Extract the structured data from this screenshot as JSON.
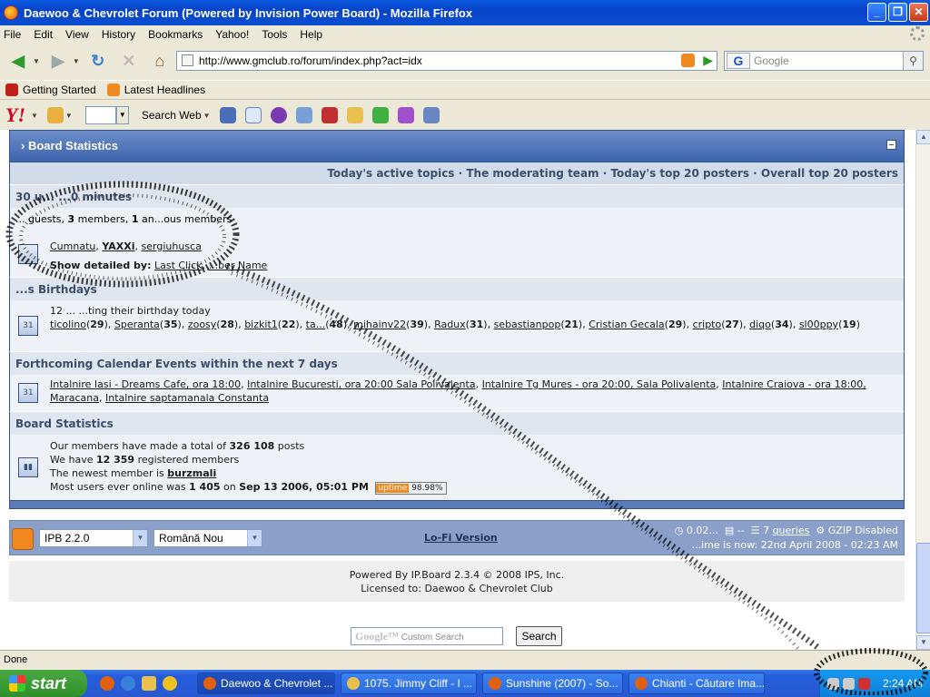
{
  "window": {
    "title": "Daewoo & Chevrolet Forum (Powered by Invision Power Board) - Mozilla Firefox"
  },
  "menu": [
    "File",
    "Edit",
    "View",
    "History",
    "Bookmarks",
    "Yahoo!",
    "Tools",
    "Help"
  ],
  "nav": {
    "url": "http://www.gmclub.ro/forum/index.php?act=idx",
    "search_placeholder": "Google"
  },
  "bookmarks": [
    {
      "label": "Getting Started",
      "icon": "firefox-icon"
    },
    {
      "label": "Latest Headlines",
      "icon": "rss-icon"
    }
  ],
  "yahoo": {
    "logo": "Y!",
    "search_label": "Search Web"
  },
  "board": {
    "title": "Board Statistics",
    "actions": "Today's active topics · The moderating team · Today's top 20 posters · Overall top 20 posters",
    "online_head": "30 u...                                  ...0 minutes",
    "online_summary_1": "... guests, ",
    "online_members_count": "3",
    "online_summary_2": " members, ",
    "online_anon_count": "1",
    "online_summary_3": " an...ous members",
    "online_users": [
      "Cumnatu",
      "YAXXi",
      "sergiuhusca"
    ],
    "detail_label": "Show detailed by:",
    "detail_links": [
      "Last Click",
      "...ber Name"
    ],
    "birthdays_head": "...s Birthdays",
    "birthday_line": "12 ...                          ...ting their birthday today",
    "birthday_users": [
      {
        "name": "ticolino",
        "age": "29"
      },
      {
        "name": "Speranta",
        "age": "35"
      },
      {
        "name": "zoosy",
        "age": "28"
      },
      {
        "name": "bizkit1",
        "age": "22"
      },
      {
        "name": "ta...",
        "age": "48"
      },
      {
        "name": "mihainv22",
        "age": "39"
      },
      {
        "name": "Radux",
        "age": "31"
      },
      {
        "name": "sebastianpop",
        "age": "21"
      },
      {
        "name": "Cristian Gecala",
        "age": "29"
      },
      {
        "name": "cripto",
        "age": "27"
      },
      {
        "name": "diqo",
        "age": "34"
      },
      {
        "name": "sl00ppy",
        "age": "19"
      }
    ],
    "calendar_head": "Forthcoming Calendar Events within the next 7 days",
    "calendar_events": [
      "Intalnire Iasi - Dreams Cafe, ora 18:00",
      "Intalnire Bucuresti, ora 20:00 Sala Polivalenta",
      "Intalnire Tg Mures - ora 20:00, Sala Polivalenta",
      "Intalnire Craiova - ora 18:00, Maracana",
      "Intalnire saptamanala Constanta"
    ],
    "stats_head": "Board Statistics",
    "stat_posts_pre": "Our members have made a total of ",
    "stat_posts": "326 108",
    "stat_posts_post": " posts",
    "stat_members_pre": "We have ",
    "stat_members": "12 359",
    "stat_members_post": " registered members",
    "stat_newest_pre": "The newest member is ",
    "stat_newest": "burzmali",
    "stat_most_pre": "Most users ever online was ",
    "stat_most": "1 405",
    "stat_most_mid": " on ",
    "stat_most_date": "Sep 13 2006, 05:01 PM",
    "uptime_label": "uptime",
    "uptime_value": "98.98%"
  },
  "footer": {
    "skin": "IPB 2.2.0",
    "language": "Română Nou",
    "lofi": "Lo-Fi Version",
    "exec_time": "0.02...",
    "queries_count": "7",
    "queries_label": "queries",
    "gzip": "GZIP Disabled",
    "time_now": "...ime is now: 22nd April 2008 - 02:23 AM",
    "powered_by": "Powered By IP.Board 2.3.4 © 2008  IPS, Inc.",
    "licensed": "Licensed to: Daewoo & Chevrolet Club",
    "custom_search_placeholder": "Custom Search",
    "custom_search_logo": "Google™",
    "search_button": "Search"
  },
  "status": {
    "text": "Done"
  },
  "taskbar": {
    "start": "start",
    "tasks": [
      {
        "label": "Daewoo & Chevrolet ...",
        "active": true
      },
      {
        "label": "1075. Jimmy Cliff - I ...",
        "active": false
      },
      {
        "label": "Sunshine (2007) - So...",
        "active": false
      },
      {
        "label": "Chianti - Căutare Ima...",
        "active": false
      }
    ],
    "clock": "2:24 AM"
  },
  "colors": {
    "accent": "#3d64ae",
    "orange_user": "#e07010",
    "xp_blue": "#245edc"
  }
}
